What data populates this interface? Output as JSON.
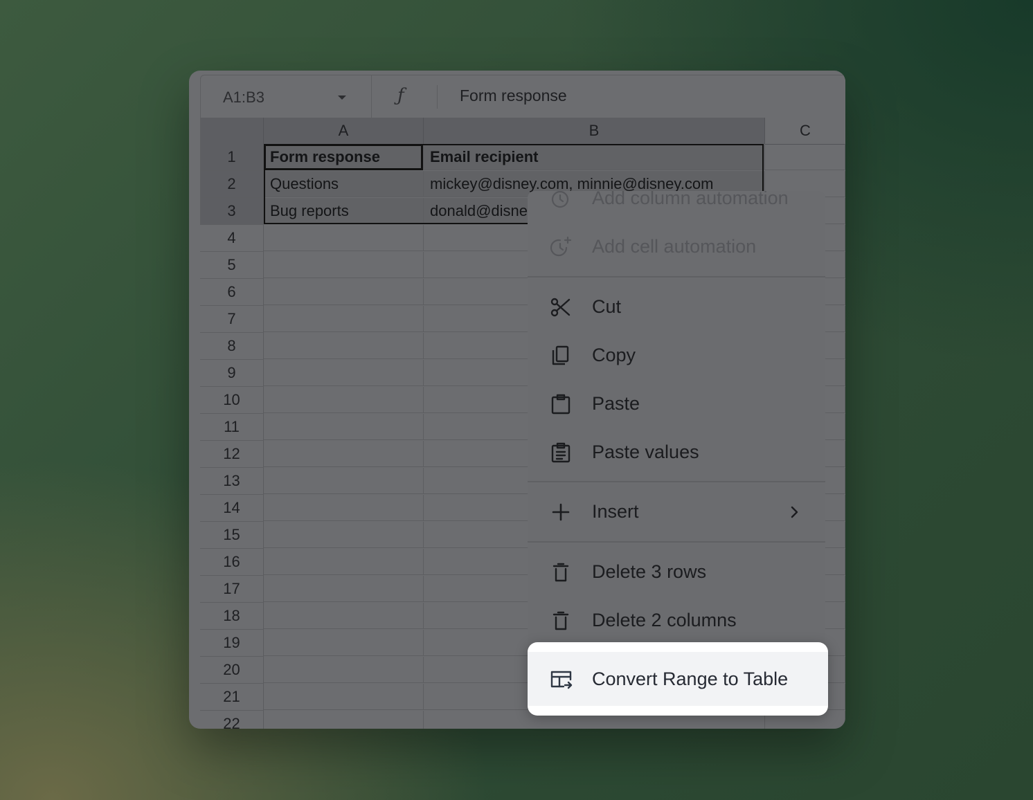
{
  "formula_bar": {
    "name_box": "A1:B3",
    "fx_symbol": "ƒ",
    "formula": "Form response"
  },
  "columns": [
    "A",
    "B",
    "C"
  ],
  "rows": [
    "1",
    "2",
    "3",
    "4",
    "5",
    "6",
    "7",
    "8",
    "9",
    "10",
    "11",
    "12",
    "13",
    "14",
    "15",
    "16",
    "17",
    "18",
    "19",
    "20",
    "21",
    "22"
  ],
  "cells": {
    "A1": "Form response",
    "B1": "Email recipient",
    "A2": "Questions",
    "B2": "mickey@disney.com, minnie@disney.com",
    "A3": "Bug reports",
    "B3": "donald@disney.com"
  },
  "context_menu": {
    "add_column_automation": "Add column automation",
    "add_cell_automation": "Add cell automation",
    "cut": "Cut",
    "copy": "Copy",
    "paste": "Paste",
    "paste_values": "Paste values",
    "insert": "Insert",
    "delete_rows": "Delete 3 rows",
    "delete_columns": "Delete 2 columns",
    "convert_range": "Convert Range to Table"
  },
  "colors": {
    "window_bg": "#6c6d70",
    "highlight_bg": "#ffffff",
    "highlight_text": "#262a33"
  }
}
